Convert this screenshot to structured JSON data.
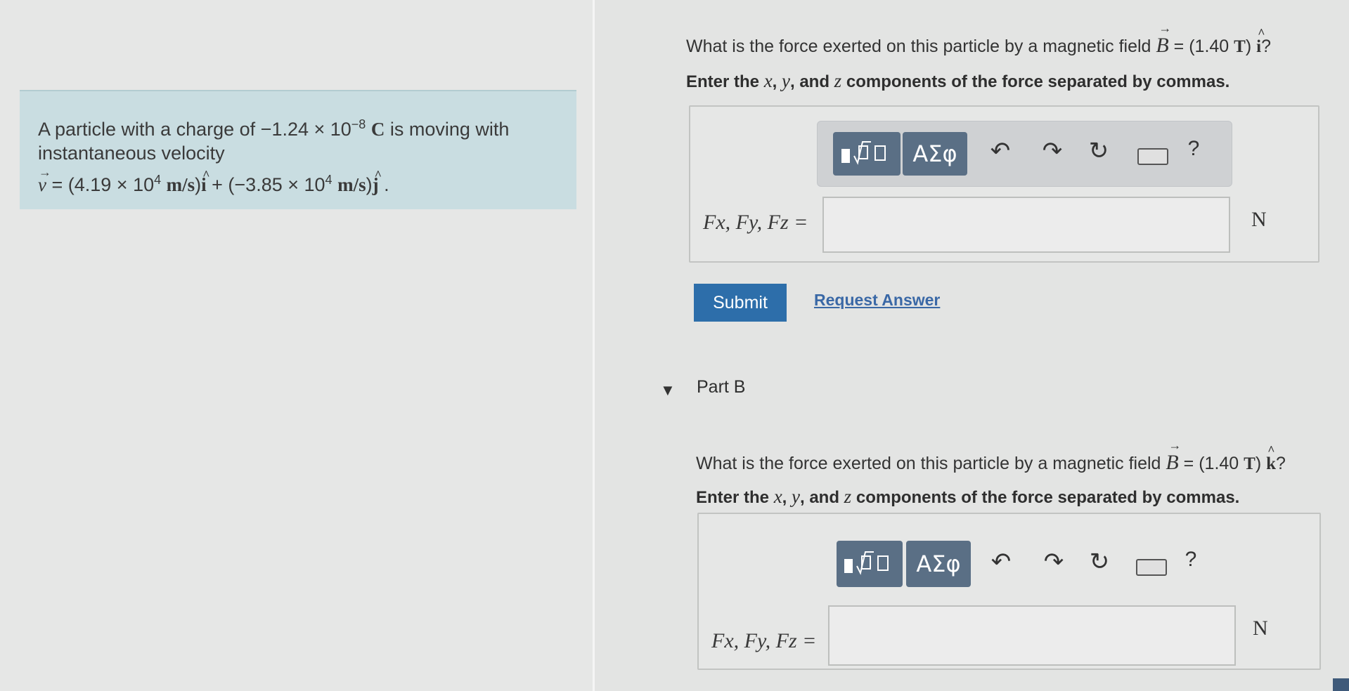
{
  "problem": {
    "line1_prefix": "A particle with a charge of ",
    "charge_value": "−1.24 × 10",
    "charge_exp": "−8",
    "charge_unit": "C",
    "line1_suffix": " is moving with",
    "line2": "instantaneous velocity",
    "velocity_symbol": "v",
    "velocity_eq": " = (4.19 × 10",
    "velocity_exp1": "4",
    "velocity_unit1": "m/s",
    "velocity_i": "i",
    "velocity_plus": " + (−3.85 × 10",
    "velocity_exp2": "4",
    "velocity_unit2": "m/s",
    "velocity_j": "j",
    "velocity_end": " ."
  },
  "part_a": {
    "question_prefix": "What is the force exerted on this particle by a magnetic field ",
    "field_symbol": "B",
    "field_value": " = (1.40 ",
    "field_unit": "T",
    "field_close": ") ",
    "field_dir": "i",
    "field_q": "?",
    "instruction_pre": "Enter the ",
    "x_var": "x",
    "comma1": ", ",
    "y_var": "y",
    "and_text": ", and ",
    "z_var": "z",
    "instruction_post": " components of the force separated by commas.",
    "label": "Fx, Fy, Fz =",
    "input_value": "",
    "unit": "N"
  },
  "toolbar": {
    "greek_label": "ΑΣφ",
    "help_label": "?"
  },
  "actions": {
    "submit_label": "Submit",
    "request_answer_label": "Request Answer"
  },
  "part_b": {
    "title": "Part B",
    "question_prefix": "What is the force exerted on this particle by a magnetic field ",
    "field_symbol": "B",
    "field_value": " = (1.40 ",
    "field_unit": "T",
    "field_close": ") ",
    "field_dir": "k",
    "field_q": "?",
    "instruction_pre": "Enter the ",
    "x_var": "x",
    "comma1": ", ",
    "y_var": "y",
    "and_text": ", and ",
    "z_var": "z",
    "instruction_post": " components of the force separated by commas.",
    "label": "Fx, Fy, Fz =",
    "input_value": "",
    "unit": "N"
  },
  "icons": {
    "template": "fraction-sqrt-template-icon",
    "undo": "undo-icon",
    "redo": "redo-icon",
    "reset": "reset-icon",
    "keyboard": "keyboard-icon",
    "help": "help-icon",
    "caret": "caret-down-icon"
  },
  "colors": {
    "submit": "#2d6eaa",
    "link": "#3a68a6",
    "problem_bg": "#c9dde1",
    "template_button": "#5a6f85"
  }
}
